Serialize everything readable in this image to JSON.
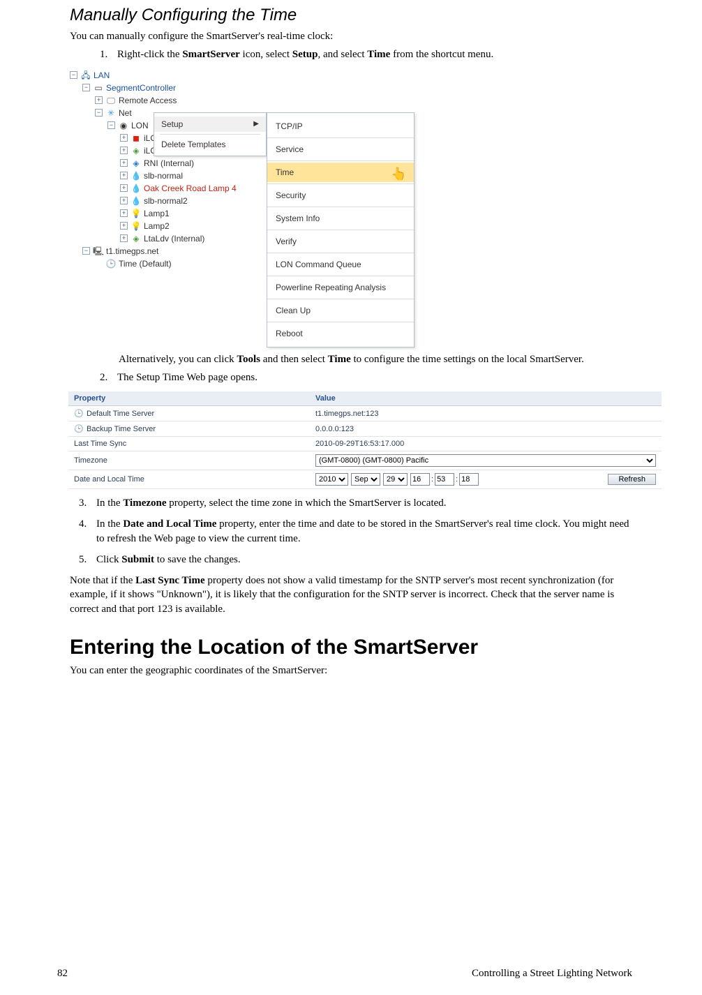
{
  "headings": {
    "h2": "Manually Configuring the Time",
    "h1": "Entering the Location of the SmartServer"
  },
  "intro": "You can manually configure the SmartServer's real-time clock:",
  "steps": {
    "s1a": "Right-click the ",
    "s1b": "SmartServer",
    "s1c": " icon, select ",
    "s1d": "Setup",
    "s1e": ", and select ",
    "s1f": "Time",
    "s1g": " from the shortcut menu.",
    "s1_alt_a": "Alternatively, you can click ",
    "s1_alt_b": "Tools",
    "s1_alt_c": " and then select ",
    "s1_alt_d": "Time",
    "s1_alt_e": " to configure the time settings on the local SmartServer.",
    "s2": "The Setup Time Web page opens.",
    "s3a": "In the ",
    "s3b": "Timezone",
    "s3c": " property, select the time zone in which the SmartServer is located.",
    "s4a": "In the ",
    "s4b": "Date and Local Time",
    "s4c": " property, enter the time and date to be stored in the SmartServer's real time clock.  You might need to refresh the Web page to view the current time.",
    "s5a": "Click ",
    "s5b": "Submit",
    "s5c": " to save the changes."
  },
  "note": {
    "a": "Note that if the ",
    "b": "Last Sync Time",
    "c": " property does not show a valid timestamp for the SNTP server's most recent synchronization (for example, if it shows \"Unknown\"), it is likely that the configuration for the SNTP server is incorrect.  Check that the server name is correct and that port 123 is available."
  },
  "loc_intro": "You can enter the geographic coordinates of the SmartServer:",
  "footer": {
    "page": "82",
    "chapter": "Controlling a Street Lighting Network"
  },
  "fig1": {
    "tree": {
      "lan": "LAN",
      "segctrl": "SegmentController",
      "remote": "Remote Access",
      "net": "Net",
      "lon": "LON",
      "ilon1": "iLON",
      "ilon2": "iLON ɴɪ (ɪɴᴛᴇʀɴᴀɪ)",
      "rni": "RNI (Internal)",
      "slb1": "slb-normal",
      "oak": "Oak Creek Road Lamp 4",
      "slb2": "slb-normal2",
      "lamp1": "Lamp1",
      "lamp2": "Lamp2",
      "ltaldv": "LtaLdv (Internal)",
      "t1": "t1.timegps.net",
      "time_default": "Time (Default)"
    },
    "ctx1": {
      "setup": "Setup",
      "delete_tmpl": "Delete Templates"
    },
    "ctx2": {
      "tcpip": "TCP/IP",
      "service": "Service",
      "time": "Time",
      "security": "Security",
      "sysinfo": "System Info",
      "verify": "Verify",
      "loncmd": "LON Command Queue",
      "powerline": "Powerline Repeating Analysis",
      "cleanup": "Clean Up",
      "reboot": "Reboot"
    }
  },
  "fig2": {
    "headers": {
      "prop": "Property",
      "val": "Value"
    },
    "rows": {
      "default_ts": {
        "label": "Default Time Server",
        "value": "t1.timegps.net:123"
      },
      "backup_ts": {
        "label": "Backup Time Server",
        "value": "0.0.0.0:123"
      },
      "last_sync": {
        "label": "Last Time Sync",
        "value": "2010-09-29T16:53:17.000"
      },
      "timezone": {
        "label": "Timezone",
        "value": "(GMT-0800) (GMT-0800) Pacific"
      },
      "datetime": {
        "label": "Date and Local Time",
        "year": "2010",
        "month": "Sep",
        "day": "29",
        "hh": "16",
        "mm": "53",
        "ss": "18",
        "refresh": "Refresh"
      }
    }
  },
  "icons": {
    "plus": "+",
    "minus": "−",
    "lan": "🖧",
    "segctrl": "▭",
    "monitor": "🖵",
    "net": "✳",
    "lon": "◉",
    "block": "◼",
    "diamond": "◈",
    "drop": "💧",
    "lamp": "💡",
    "host": "🖳",
    "clock": "🕒",
    "arrow": "▶",
    "hand": "👆"
  }
}
